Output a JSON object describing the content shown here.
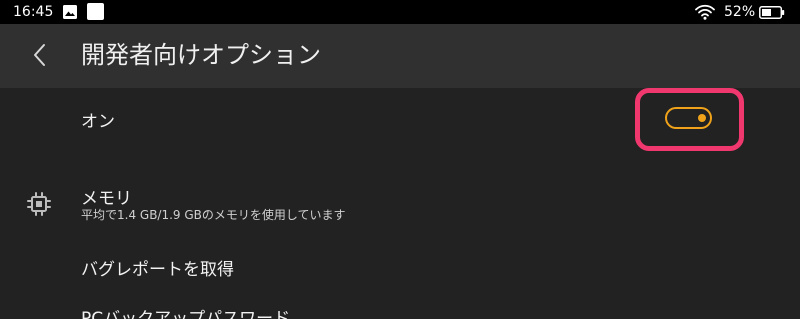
{
  "status_bar": {
    "time": "16:45",
    "battery_text": "52%",
    "icons": [
      "gallery-icon",
      "square-notification-icon",
      "wifi-icon",
      "battery-icon"
    ]
  },
  "header": {
    "back_icon": "chevron-left-icon",
    "title": "開発者向けオプション"
  },
  "toggle_row": {
    "label": "オン",
    "state": "on",
    "accent_color": "#f0a21a",
    "highlight_color": "#f0386e"
  },
  "settings": {
    "memory": {
      "icon": "memory-chip-icon",
      "title": "メモリ",
      "subtitle": "平均で1.4 GB/1.9 GBのメモリを使用しています"
    },
    "bug_report": {
      "title": "バグレポートを取得"
    },
    "pc_backup": {
      "title": "PCバックアップパスワード"
    }
  }
}
